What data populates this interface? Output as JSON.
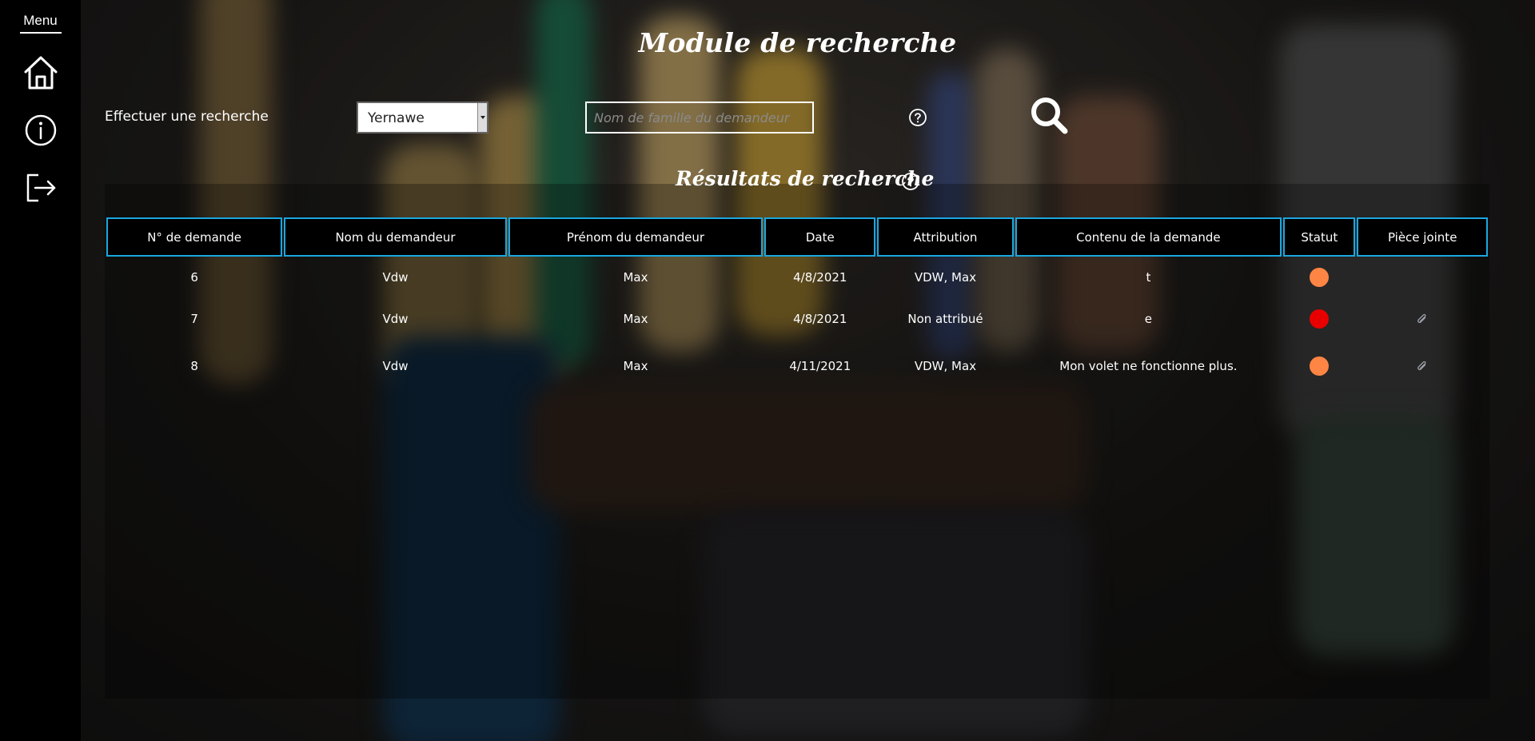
{
  "sidebar": {
    "menu_label": "Menu",
    "icons": [
      "home-icon",
      "info-icon",
      "logout-icon"
    ]
  },
  "page": {
    "title": "Module de recherche",
    "search_label": "Effectuer une recherche",
    "select_value": "Yernawe",
    "search_placeholder": "Nom de famille du demandeur",
    "results_title": "Résultats de recherche"
  },
  "colors": {
    "accent": "#1aa7e0",
    "status_orange": "#ff8544",
    "status_red": "#e80000"
  },
  "table": {
    "headers": [
      "N° de demande",
      "Nom du demandeur",
      "Prénom du demandeur",
      "Date",
      "Attribution",
      "Contenu de la demande",
      "Statut",
      "Pièce jointe"
    ],
    "rows": [
      {
        "num": "6",
        "nom": "Vdw",
        "prenom": "Max",
        "date": "4/8/2021",
        "attribution": "VDW, Max",
        "contenu": "t",
        "statut": "orange",
        "piece_jointe": false
      },
      {
        "num": "7",
        "nom": "Vdw",
        "prenom": "Max",
        "date": "4/8/2021",
        "attribution": "Non attribué",
        "contenu": "e",
        "statut": "red",
        "piece_jointe": true
      },
      {
        "num": "8",
        "nom": "Vdw",
        "prenom": "Max",
        "date": "4/11/2021",
        "attribution": "VDW, Max",
        "contenu": "Mon volet ne fonctionne plus.",
        "statut": "orange",
        "piece_jointe": true
      }
    ]
  }
}
